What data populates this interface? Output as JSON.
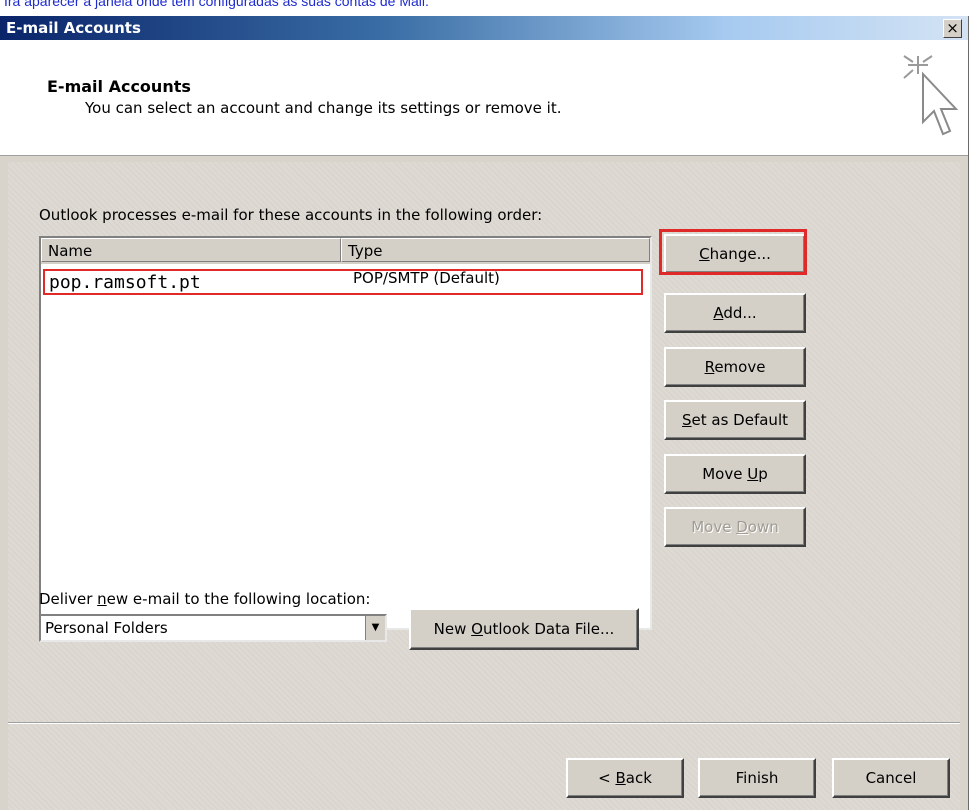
{
  "caption": "Irá aparecer a janela onde tem configuradas as suas contas de Mail.",
  "window": {
    "title": "E-mail Accounts",
    "close_label": "×"
  },
  "header": {
    "title": "E-mail Accounts",
    "subtitle": "You can select an account and change its settings or remove it."
  },
  "accounts": {
    "prompt": "Outlook processes e-mail for these accounts in the following order:",
    "columns": [
      "Name",
      "Type"
    ],
    "rows": [
      {
        "name": "pop.ramsoft.pt",
        "type": "POP/SMTP (Default)"
      }
    ]
  },
  "buttons": {
    "change": {
      "pre": "",
      "key": "C",
      "post": "hange..."
    },
    "add": {
      "pre": "",
      "key": "A",
      "post": "dd..."
    },
    "remove": {
      "pre": "",
      "key": "R",
      "post": "emove"
    },
    "set_default": {
      "pre": "",
      "key": "S",
      "post": "et as Default"
    },
    "move_up": {
      "pre": "Move ",
      "key": "U",
      "post": "p"
    },
    "move_down": {
      "pre": "Move ",
      "key": "D",
      "post": "own"
    }
  },
  "delivery": {
    "label_pre": "Deliver ",
    "label_key": "n",
    "label_post": "ew e-mail to the following location:",
    "selected": "Personal Folders",
    "new_file": {
      "pre": "New ",
      "key": "O",
      "post": "utlook Data File..."
    }
  },
  "footer": {
    "back": {
      "pre": "< ",
      "key": "B",
      "post": "ack"
    },
    "finish": "Finish",
    "cancel": "Cancel"
  },
  "colors": {
    "highlight": "#e02a2a",
    "caption": "#1e2bd0"
  }
}
